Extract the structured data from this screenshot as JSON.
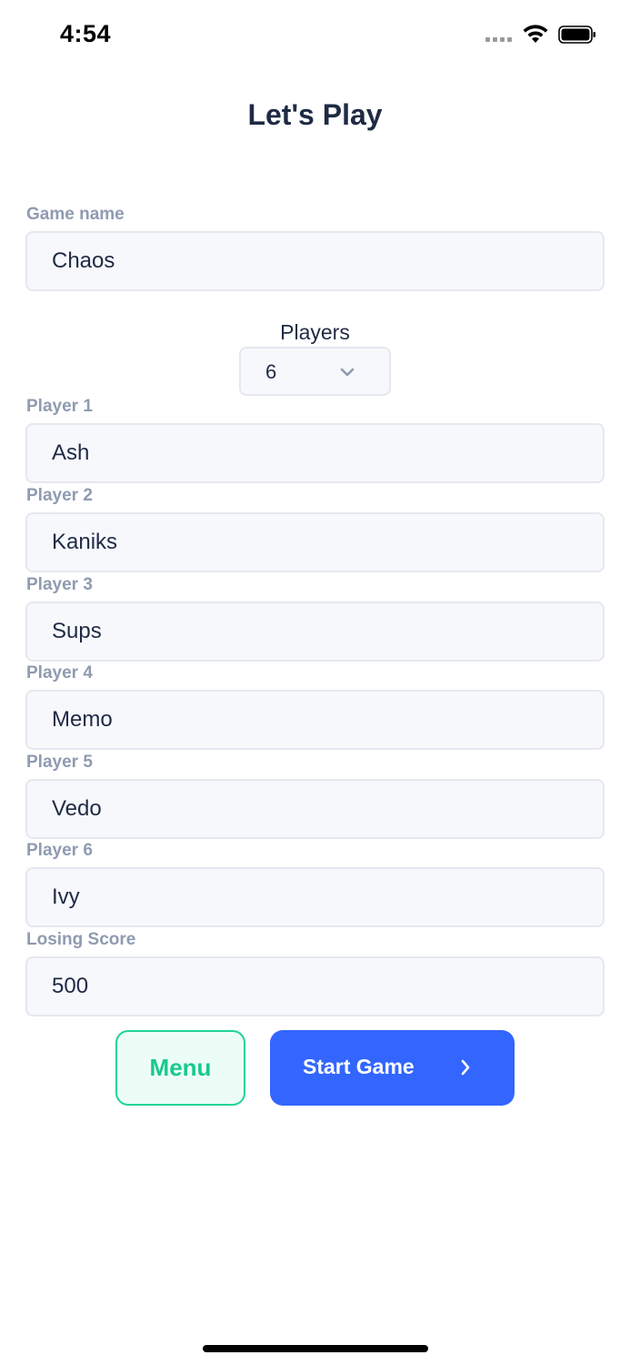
{
  "status_bar": {
    "time": "4:54"
  },
  "page": {
    "title": "Let's Play"
  },
  "game_name": {
    "label": "Game name",
    "value": "Chaos"
  },
  "players": {
    "label": "Players",
    "selected": "6"
  },
  "player_fields": [
    {
      "label": "Player 1",
      "value": "Ash"
    },
    {
      "label": "Player 2",
      "value": "Kaniks"
    },
    {
      "label": "Player 3",
      "value": "Sups"
    },
    {
      "label": "Player 4",
      "value": "Memo"
    },
    {
      "label": "Player 5",
      "value": "Vedo"
    },
    {
      "label": "Player 6",
      "value": "Ivy"
    }
  ],
  "losing_score": {
    "label": "Losing Score",
    "value": "500"
  },
  "buttons": {
    "menu_label": "Menu",
    "start_label": "Start Game"
  },
  "icons": {
    "signal": "cellular-signal-icon",
    "wifi": "wifi-icon",
    "battery": "battery-icon",
    "dropdown": "chevron-down-icon",
    "start_arrow": "chevron-right-icon"
  },
  "colors": {
    "title_text": "#1f2a44",
    "label_text": "#8f9bb0",
    "input_bg": "#f7f8fc",
    "input_border": "#e5e8ef",
    "menu_accent": "#1fd39b",
    "menu_bg": "#ecfdf7",
    "primary": "#3366ff"
  }
}
